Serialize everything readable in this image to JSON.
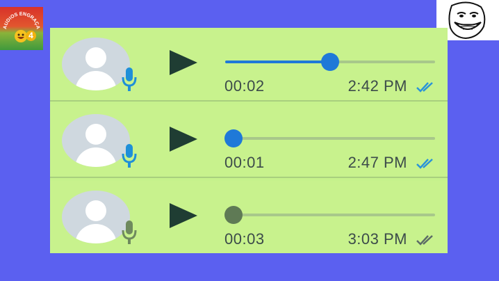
{
  "logo": {
    "text": "AUDIOS ENGRAÇADOS",
    "number": "4"
  },
  "messages": [
    {
      "duration": "00:02",
      "time": "2:42 PM",
      "progress": 0.5,
      "status": "played",
      "mic_color": "#1f8fd8",
      "knob_color": "#1f79d8",
      "ticks_color": "#2a93d8"
    },
    {
      "duration": "00:01",
      "time": "2:47 PM",
      "progress": 0.04,
      "status": "played",
      "mic_color": "#1f8fd8",
      "knob_color": "#1f79d8",
      "ticks_color": "#2a93d8"
    },
    {
      "duration": "00:03",
      "time": "3:03 PM",
      "progress": 0.04,
      "status": "delivered",
      "mic_color": "#6f8a5e",
      "knob_color": "#5f7a55",
      "ticks_color": "#5c6b66"
    }
  ]
}
